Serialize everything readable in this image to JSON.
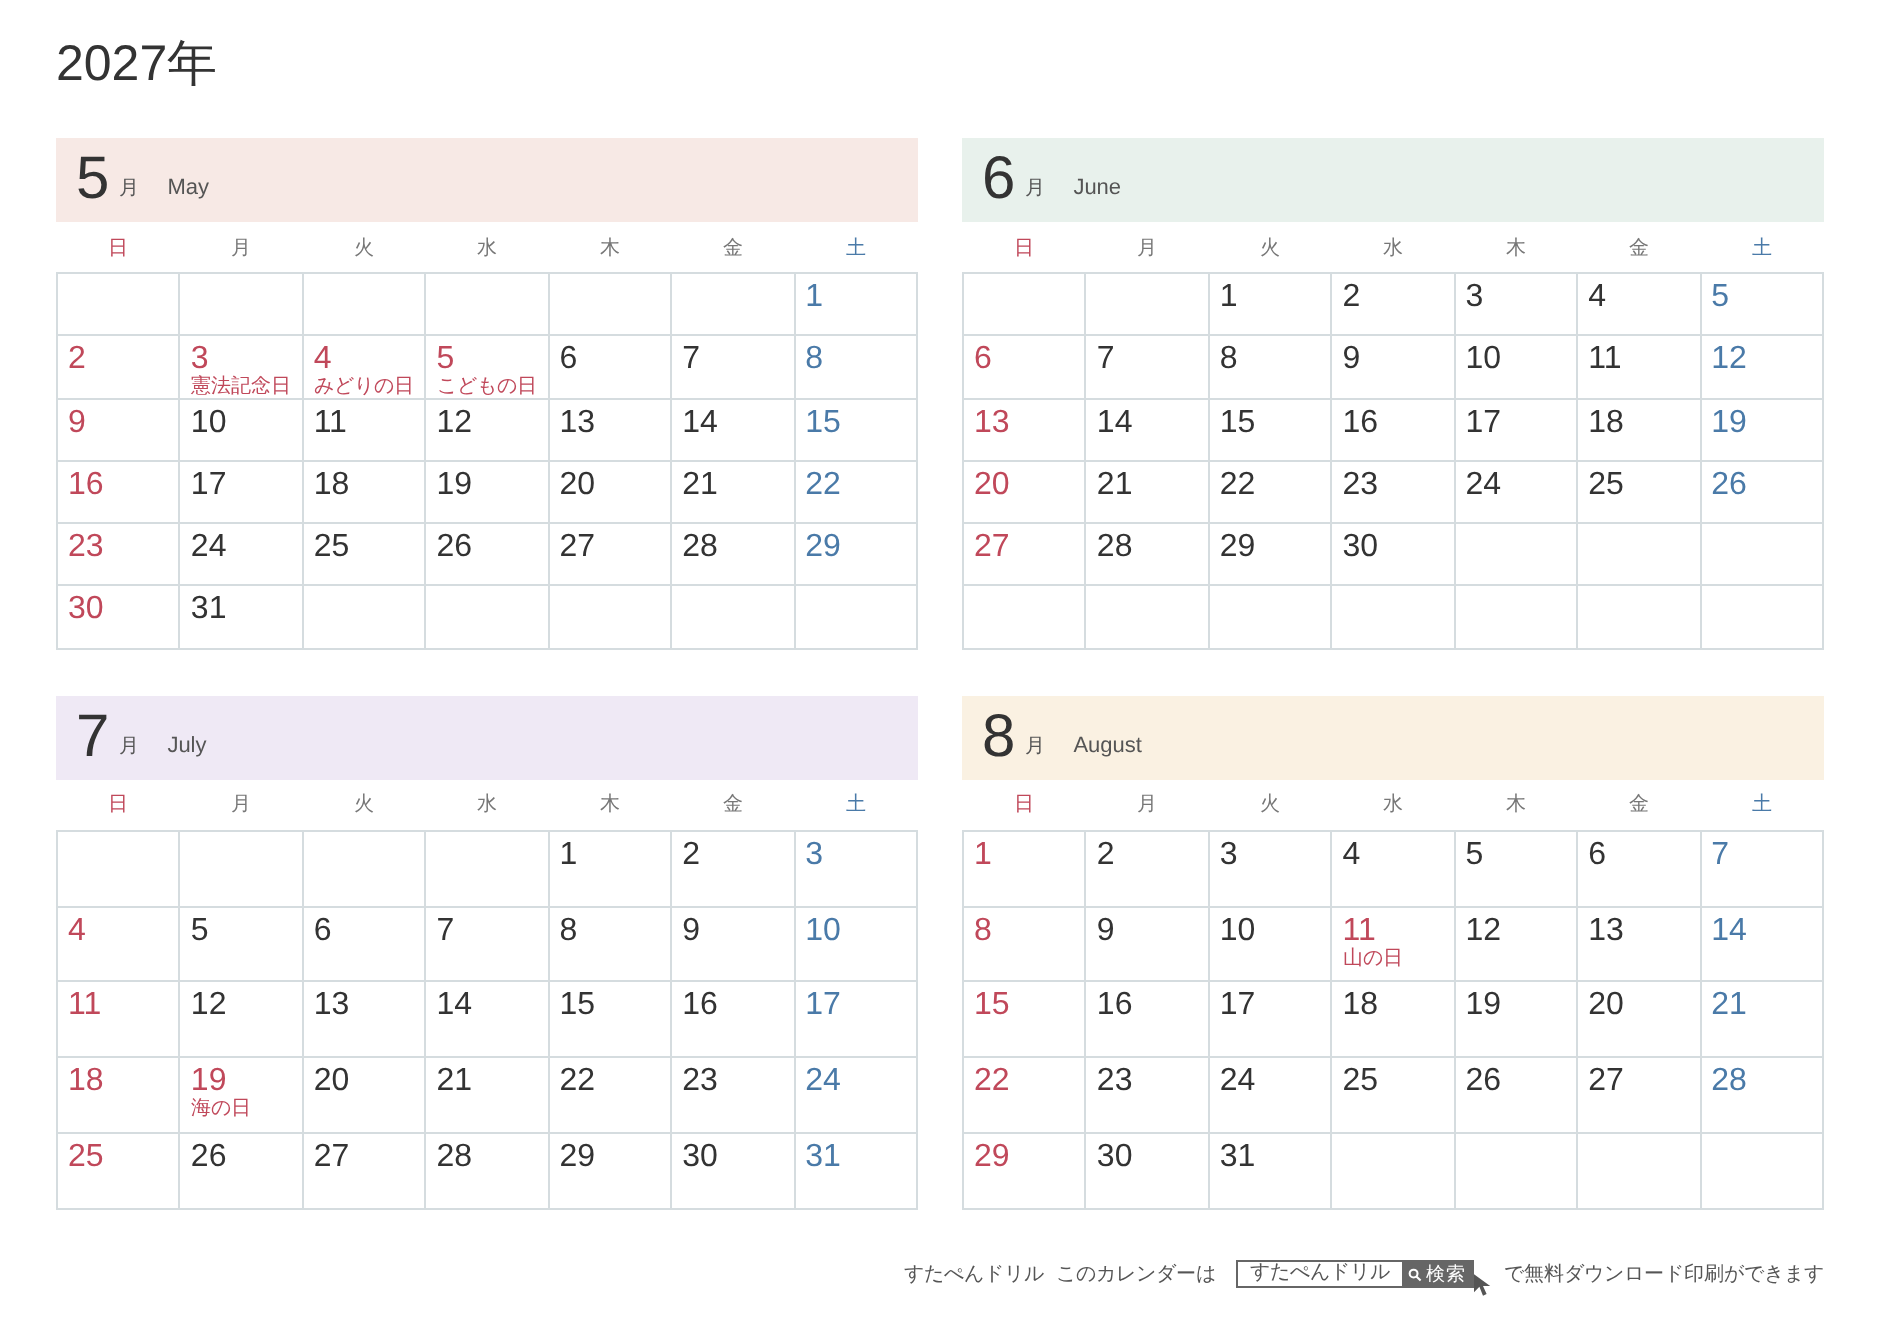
{
  "title": "2027年",
  "months": [
    {
      "number": "5",
      "unit": "月",
      "name": "May",
      "color": "#f7e9e5",
      "weekdays": [
        {
          "label": "日",
          "kind": "sunday"
        },
        {
          "label": "月",
          "kind": "weekday"
        },
        {
          "label": "火",
          "kind": "weekday"
        },
        {
          "label": "水",
          "kind": "weekday"
        },
        {
          "label": "木",
          "kind": "weekday"
        },
        {
          "label": "金",
          "kind": "weekday"
        },
        {
          "label": "土",
          "kind": "saturday"
        }
      ],
      "weeks": [
        [
          {
            "kind": "blank"
          },
          {
            "kind": "blank"
          },
          {
            "kind": "blank"
          },
          {
            "kind": "blank"
          },
          {
            "kind": "blank"
          },
          {
            "kind": "blank"
          },
          {
            "day": "1",
            "kind": "saturday"
          }
        ],
        [
          {
            "day": "2",
            "kind": "sunday"
          },
          {
            "day": "3",
            "kind": "holiday",
            "holiday": "憲法記念日"
          },
          {
            "day": "4",
            "kind": "holiday",
            "holiday": "みどりの日"
          },
          {
            "day": "5",
            "kind": "holiday",
            "holiday": "こどもの日"
          },
          {
            "day": "6",
            "kind": "weekday"
          },
          {
            "day": "7",
            "kind": "weekday"
          },
          {
            "day": "8",
            "kind": "saturday"
          }
        ],
        [
          {
            "day": "9",
            "kind": "sunday"
          },
          {
            "day": "10",
            "kind": "weekday"
          },
          {
            "day": "11",
            "kind": "weekday"
          },
          {
            "day": "12",
            "kind": "weekday"
          },
          {
            "day": "13",
            "kind": "weekday"
          },
          {
            "day": "14",
            "kind": "weekday"
          },
          {
            "day": "15",
            "kind": "saturday"
          }
        ],
        [
          {
            "day": "16",
            "kind": "sunday"
          },
          {
            "day": "17",
            "kind": "weekday"
          },
          {
            "day": "18",
            "kind": "weekday"
          },
          {
            "day": "19",
            "kind": "weekday"
          },
          {
            "day": "20",
            "kind": "weekday"
          },
          {
            "day": "21",
            "kind": "weekday"
          },
          {
            "day": "22",
            "kind": "saturday"
          }
        ],
        [
          {
            "day": "23",
            "kind": "sunday"
          },
          {
            "day": "24",
            "kind": "weekday"
          },
          {
            "day": "25",
            "kind": "weekday"
          },
          {
            "day": "26",
            "kind": "weekday"
          },
          {
            "day": "27",
            "kind": "weekday"
          },
          {
            "day": "28",
            "kind": "weekday"
          },
          {
            "day": "29",
            "kind": "saturday"
          }
        ],
        [
          {
            "day": "30",
            "kind": "sunday"
          },
          {
            "day": "31",
            "kind": "weekday"
          },
          {
            "kind": "blank"
          },
          {
            "kind": "blank"
          },
          {
            "kind": "blank"
          },
          {
            "kind": "blank"
          },
          {
            "kind": "blank"
          }
        ]
      ]
    },
    {
      "number": "6",
      "unit": "月",
      "name": "June",
      "color": "#e8f1ec",
      "weekdays": [
        {
          "label": "日",
          "kind": "sunday"
        },
        {
          "label": "月",
          "kind": "weekday"
        },
        {
          "label": "火",
          "kind": "weekday"
        },
        {
          "label": "水",
          "kind": "weekday"
        },
        {
          "label": "木",
          "kind": "weekday"
        },
        {
          "label": "金",
          "kind": "weekday"
        },
        {
          "label": "土",
          "kind": "saturday"
        }
      ],
      "weeks": [
        [
          {
            "kind": "blank"
          },
          {
            "kind": "blank"
          },
          {
            "day": "1",
            "kind": "weekday"
          },
          {
            "day": "2",
            "kind": "weekday"
          },
          {
            "day": "3",
            "kind": "weekday"
          },
          {
            "day": "4",
            "kind": "weekday"
          },
          {
            "day": "5",
            "kind": "saturday"
          }
        ],
        [
          {
            "day": "6",
            "kind": "sunday"
          },
          {
            "day": "7",
            "kind": "weekday"
          },
          {
            "day": "8",
            "kind": "weekday"
          },
          {
            "day": "9",
            "kind": "weekday"
          },
          {
            "day": "10",
            "kind": "weekday"
          },
          {
            "day": "11",
            "kind": "weekday"
          },
          {
            "day": "12",
            "kind": "saturday"
          }
        ],
        [
          {
            "day": "13",
            "kind": "sunday"
          },
          {
            "day": "14",
            "kind": "weekday"
          },
          {
            "day": "15",
            "kind": "weekday"
          },
          {
            "day": "16",
            "kind": "weekday"
          },
          {
            "day": "17",
            "kind": "weekday"
          },
          {
            "day": "18",
            "kind": "weekday"
          },
          {
            "day": "19",
            "kind": "saturday"
          }
        ],
        [
          {
            "day": "20",
            "kind": "sunday"
          },
          {
            "day": "21",
            "kind": "weekday"
          },
          {
            "day": "22",
            "kind": "weekday"
          },
          {
            "day": "23",
            "kind": "weekday"
          },
          {
            "day": "24",
            "kind": "weekday"
          },
          {
            "day": "25",
            "kind": "weekday"
          },
          {
            "day": "26",
            "kind": "saturday"
          }
        ],
        [
          {
            "day": "27",
            "kind": "sunday"
          },
          {
            "day": "28",
            "kind": "weekday"
          },
          {
            "day": "29",
            "kind": "weekday"
          },
          {
            "day": "30",
            "kind": "weekday"
          },
          {
            "kind": "blank"
          },
          {
            "kind": "blank"
          },
          {
            "kind": "blank"
          }
        ],
        [
          {
            "kind": "blank"
          },
          {
            "kind": "blank"
          },
          {
            "kind": "blank"
          },
          {
            "kind": "blank"
          },
          {
            "kind": "blank"
          },
          {
            "kind": "blank"
          },
          {
            "kind": "blank"
          }
        ]
      ]
    },
    {
      "number": "7",
      "unit": "月",
      "name": "July",
      "color": "#efe9f5",
      "weekdays": [
        {
          "label": "日",
          "kind": "sunday"
        },
        {
          "label": "月",
          "kind": "weekday"
        },
        {
          "label": "火",
          "kind": "weekday"
        },
        {
          "label": "水",
          "kind": "weekday"
        },
        {
          "label": "木",
          "kind": "weekday"
        },
        {
          "label": "金",
          "kind": "weekday"
        },
        {
          "label": "土",
          "kind": "saturday"
        }
      ],
      "weeks": [
        [
          {
            "kind": "blank"
          },
          {
            "kind": "blank"
          },
          {
            "kind": "blank"
          },
          {
            "kind": "blank"
          },
          {
            "day": "1",
            "kind": "weekday"
          },
          {
            "day": "2",
            "kind": "weekday"
          },
          {
            "day": "3",
            "kind": "saturday"
          }
        ],
        [
          {
            "day": "4",
            "kind": "sunday"
          },
          {
            "day": "5",
            "kind": "weekday"
          },
          {
            "day": "6",
            "kind": "weekday"
          },
          {
            "day": "7",
            "kind": "weekday"
          },
          {
            "day": "8",
            "kind": "weekday"
          },
          {
            "day": "9",
            "kind": "weekday"
          },
          {
            "day": "10",
            "kind": "saturday"
          }
        ],
        [
          {
            "day": "11",
            "kind": "sunday"
          },
          {
            "day": "12",
            "kind": "weekday"
          },
          {
            "day": "13",
            "kind": "weekday"
          },
          {
            "day": "14",
            "kind": "weekday"
          },
          {
            "day": "15",
            "kind": "weekday"
          },
          {
            "day": "16",
            "kind": "weekday"
          },
          {
            "day": "17",
            "kind": "saturday"
          }
        ],
        [
          {
            "day": "18",
            "kind": "sunday"
          },
          {
            "day": "19",
            "kind": "holiday",
            "holiday": "海の日"
          },
          {
            "day": "20",
            "kind": "weekday"
          },
          {
            "day": "21",
            "kind": "weekday"
          },
          {
            "day": "22",
            "kind": "weekday"
          },
          {
            "day": "23",
            "kind": "weekday"
          },
          {
            "day": "24",
            "kind": "saturday"
          }
        ],
        [
          {
            "day": "25",
            "kind": "sunday"
          },
          {
            "day": "26",
            "kind": "weekday"
          },
          {
            "day": "27",
            "kind": "weekday"
          },
          {
            "day": "28",
            "kind": "weekday"
          },
          {
            "day": "29",
            "kind": "weekday"
          },
          {
            "day": "30",
            "kind": "weekday"
          },
          {
            "day": "31",
            "kind": "saturday"
          }
        ]
      ]
    },
    {
      "number": "8",
      "unit": "月",
      "name": "August",
      "color": "#faf1e2",
      "weekdays": [
        {
          "label": "日",
          "kind": "sunday"
        },
        {
          "label": "月",
          "kind": "weekday"
        },
        {
          "label": "火",
          "kind": "weekday"
        },
        {
          "label": "水",
          "kind": "weekday"
        },
        {
          "label": "木",
          "kind": "weekday"
        },
        {
          "label": "金",
          "kind": "weekday"
        },
        {
          "label": "土",
          "kind": "saturday"
        }
      ],
      "weeks": [
        [
          {
            "day": "1",
            "kind": "sunday"
          },
          {
            "day": "2",
            "kind": "weekday"
          },
          {
            "day": "3",
            "kind": "weekday"
          },
          {
            "day": "4",
            "kind": "weekday"
          },
          {
            "day": "5",
            "kind": "weekday"
          },
          {
            "day": "6",
            "kind": "weekday"
          },
          {
            "day": "7",
            "kind": "saturday"
          }
        ],
        [
          {
            "day": "8",
            "kind": "sunday"
          },
          {
            "day": "9",
            "kind": "weekday"
          },
          {
            "day": "10",
            "kind": "weekday"
          },
          {
            "day": "11",
            "kind": "holiday",
            "holiday": "山の日"
          },
          {
            "day": "12",
            "kind": "weekday"
          },
          {
            "day": "13",
            "kind": "weekday"
          },
          {
            "day": "14",
            "kind": "saturday"
          }
        ],
        [
          {
            "day": "15",
            "kind": "sunday"
          },
          {
            "day": "16",
            "kind": "weekday"
          },
          {
            "day": "17",
            "kind": "weekday"
          },
          {
            "day": "18",
            "kind": "weekday"
          },
          {
            "day": "19",
            "kind": "weekday"
          },
          {
            "day": "20",
            "kind": "weekday"
          },
          {
            "day": "21",
            "kind": "saturday"
          }
        ],
        [
          {
            "day": "22",
            "kind": "sunday"
          },
          {
            "day": "23",
            "kind": "weekday"
          },
          {
            "day": "24",
            "kind": "weekday"
          },
          {
            "day": "25",
            "kind": "weekday"
          },
          {
            "day": "26",
            "kind": "weekday"
          },
          {
            "day": "27",
            "kind": "weekday"
          },
          {
            "day": "28",
            "kind": "saturday"
          }
        ],
        [
          {
            "day": "29",
            "kind": "sunday"
          },
          {
            "day": "30",
            "kind": "weekday"
          },
          {
            "day": "31",
            "kind": "weekday"
          },
          {
            "kind": "blank"
          },
          {
            "kind": "blank"
          },
          {
            "kind": "blank"
          },
          {
            "kind": "blank"
          }
        ]
      ]
    }
  ],
  "footer": {
    "brand": "すたぺんドリル",
    "lead": "このカレンダーは",
    "search_value": "すたぺんドリル",
    "search_button": "検索",
    "tail": "で無料ダウンロード印刷ができます"
  }
}
